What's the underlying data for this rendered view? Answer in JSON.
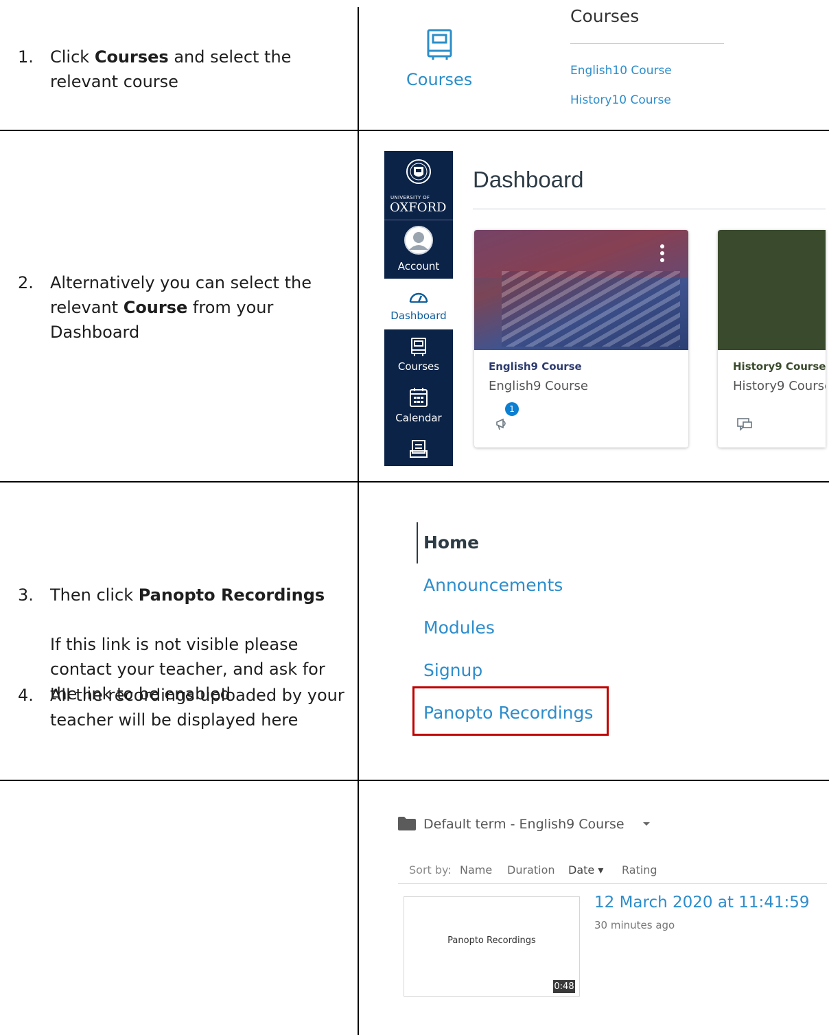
{
  "steps": [
    {
      "number": "1.",
      "pre": "Click ",
      "bold": "Courses",
      "post": " and select the relevant course"
    },
    {
      "number": "2.",
      "pre": "Alternatively you can select the relevant ",
      "bold": "Course",
      "post": " from your Dashboard"
    },
    {
      "number": "3.",
      "pre": "Then click ",
      "bold": "Panopto Recordings",
      "post": "",
      "note": "If this link is not visible please contact your teacher, and ask for the link to be enabled"
    },
    {
      "number": "4.",
      "pre": "All the recordings uploaded by your teacher will be displayed here",
      "bold": "",
      "post": ""
    }
  ],
  "section1": {
    "icon_label": "Courses",
    "panel_title": "Courses",
    "links": [
      "English10 Course",
      "History10 Course"
    ]
  },
  "section2": {
    "logo_line1": "UNIVERSITY OF",
    "logo_line2": "OXFORD",
    "nav": [
      "Account",
      "Dashboard",
      "Courses",
      "Calendar"
    ],
    "title": "Dashboard",
    "cards": [
      {
        "title": "English9 Course",
        "subtitle": "English9 Course",
        "badge": "1",
        "color": "#3b4a7a"
      },
      {
        "title": "History9 Course",
        "subtitle": "History9 Course",
        "color": "#3a4a2c"
      }
    ]
  },
  "section3": {
    "menu": [
      "Home",
      "Announcements",
      "Modules",
      "Signup",
      "Panopto Recordings"
    ],
    "highlight_color": "#c00000"
  },
  "section4": {
    "folder": "Default term - English9 Course",
    "sort_label": "Sort by:",
    "sort_options": [
      "Name",
      "Duration",
      "Date ▾",
      "Rating"
    ],
    "thumb_text": "Panopto Recordings",
    "duration": "0:48",
    "recording_title": "12 March 2020 at 11:41:59",
    "recording_time": "30 minutes ago"
  },
  "colors": {
    "link": "#2d8dcc",
    "nav": "#0c2348"
  }
}
